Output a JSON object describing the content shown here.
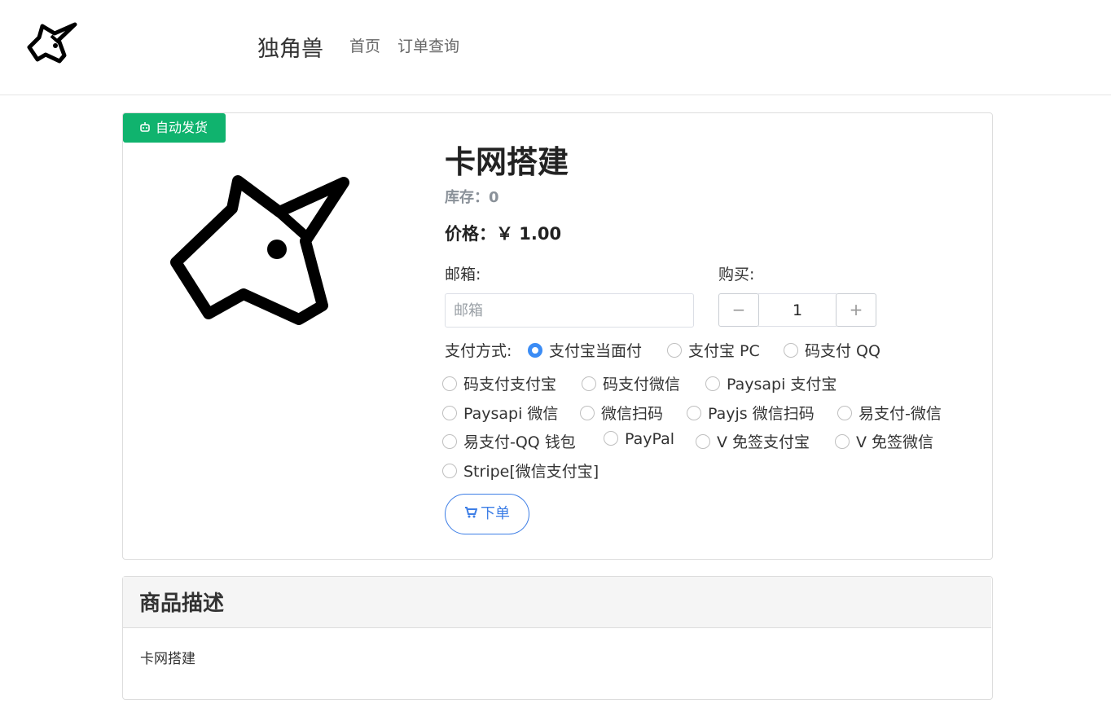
{
  "header": {
    "brand": "独角兽",
    "nav": [
      "首页",
      "订单查询"
    ]
  },
  "product": {
    "badge": "自动发货",
    "title": "卡网搭建",
    "stock": "库存：0",
    "price": "价格：￥ 1.00",
    "email_label": "邮箱:",
    "email_placeholder": "邮箱",
    "buy_label": "购买:",
    "quantity": "1",
    "minus": "−",
    "plus": "+",
    "payment_label": "支付方式:",
    "payment_methods": [
      "支付宝当面付",
      "支付宝 PC",
      "码支付 QQ",
      "码支付支付宝",
      "码支付微信",
      "Paysapi 支付宝",
      "Paysapi 微信",
      "微信扫码",
      "Payjs 微信扫码",
      "易支付-微信",
      "易支付-QQ 钱包",
      "PayPal",
      "V 免签支付宝",
      "V 免签微信",
      "Stripe[微信支付宝]"
    ],
    "selected_payment": "支付宝当面付",
    "order_button": "下单"
  },
  "description": {
    "title": "商品描述",
    "body": "卡网搭建"
  },
  "colors": {
    "badge": "#10b36e",
    "radio_checked": "#3b8cf5",
    "order_button": "#3d7ee6"
  },
  "icons": [
    "unicorn-logo",
    "robot-icon",
    "cart-icon"
  ]
}
